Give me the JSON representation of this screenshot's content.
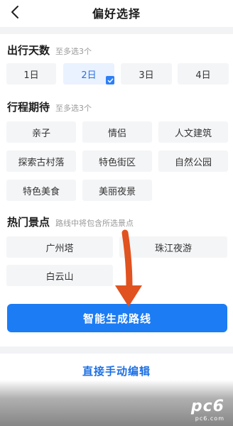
{
  "header": {
    "title": "偏好选择"
  },
  "sections": {
    "days": {
      "title": "出行天数",
      "hint": "至多选3个",
      "options": [
        "1日",
        "2日",
        "3日",
        "4日"
      ]
    },
    "expect": {
      "title": "行程期待",
      "hint": "至多选3个",
      "options": [
        "亲子",
        "情侣",
        "人文建筑",
        "探索古村落",
        "特色街区",
        "自然公园",
        "特色美食",
        "美丽夜景"
      ]
    },
    "spots": {
      "title": "热门景点",
      "hint": "路线中将包含所选景点",
      "options": [
        "广州塔",
        "珠江夜游",
        "白云山"
      ]
    }
  },
  "actions": {
    "generate_label": "智能生成路线",
    "manual_label": "直接手动编辑"
  },
  "selected_day": "2日",
  "colors": {
    "accent": "#1c7cf4",
    "selected_bg": "#eaf2ff",
    "option_bg": "#f4f5f7",
    "annotation_arrow": "#e0521f"
  },
  "watermark": {
    "logo": "pc6",
    "sub": "pc6.com"
  }
}
